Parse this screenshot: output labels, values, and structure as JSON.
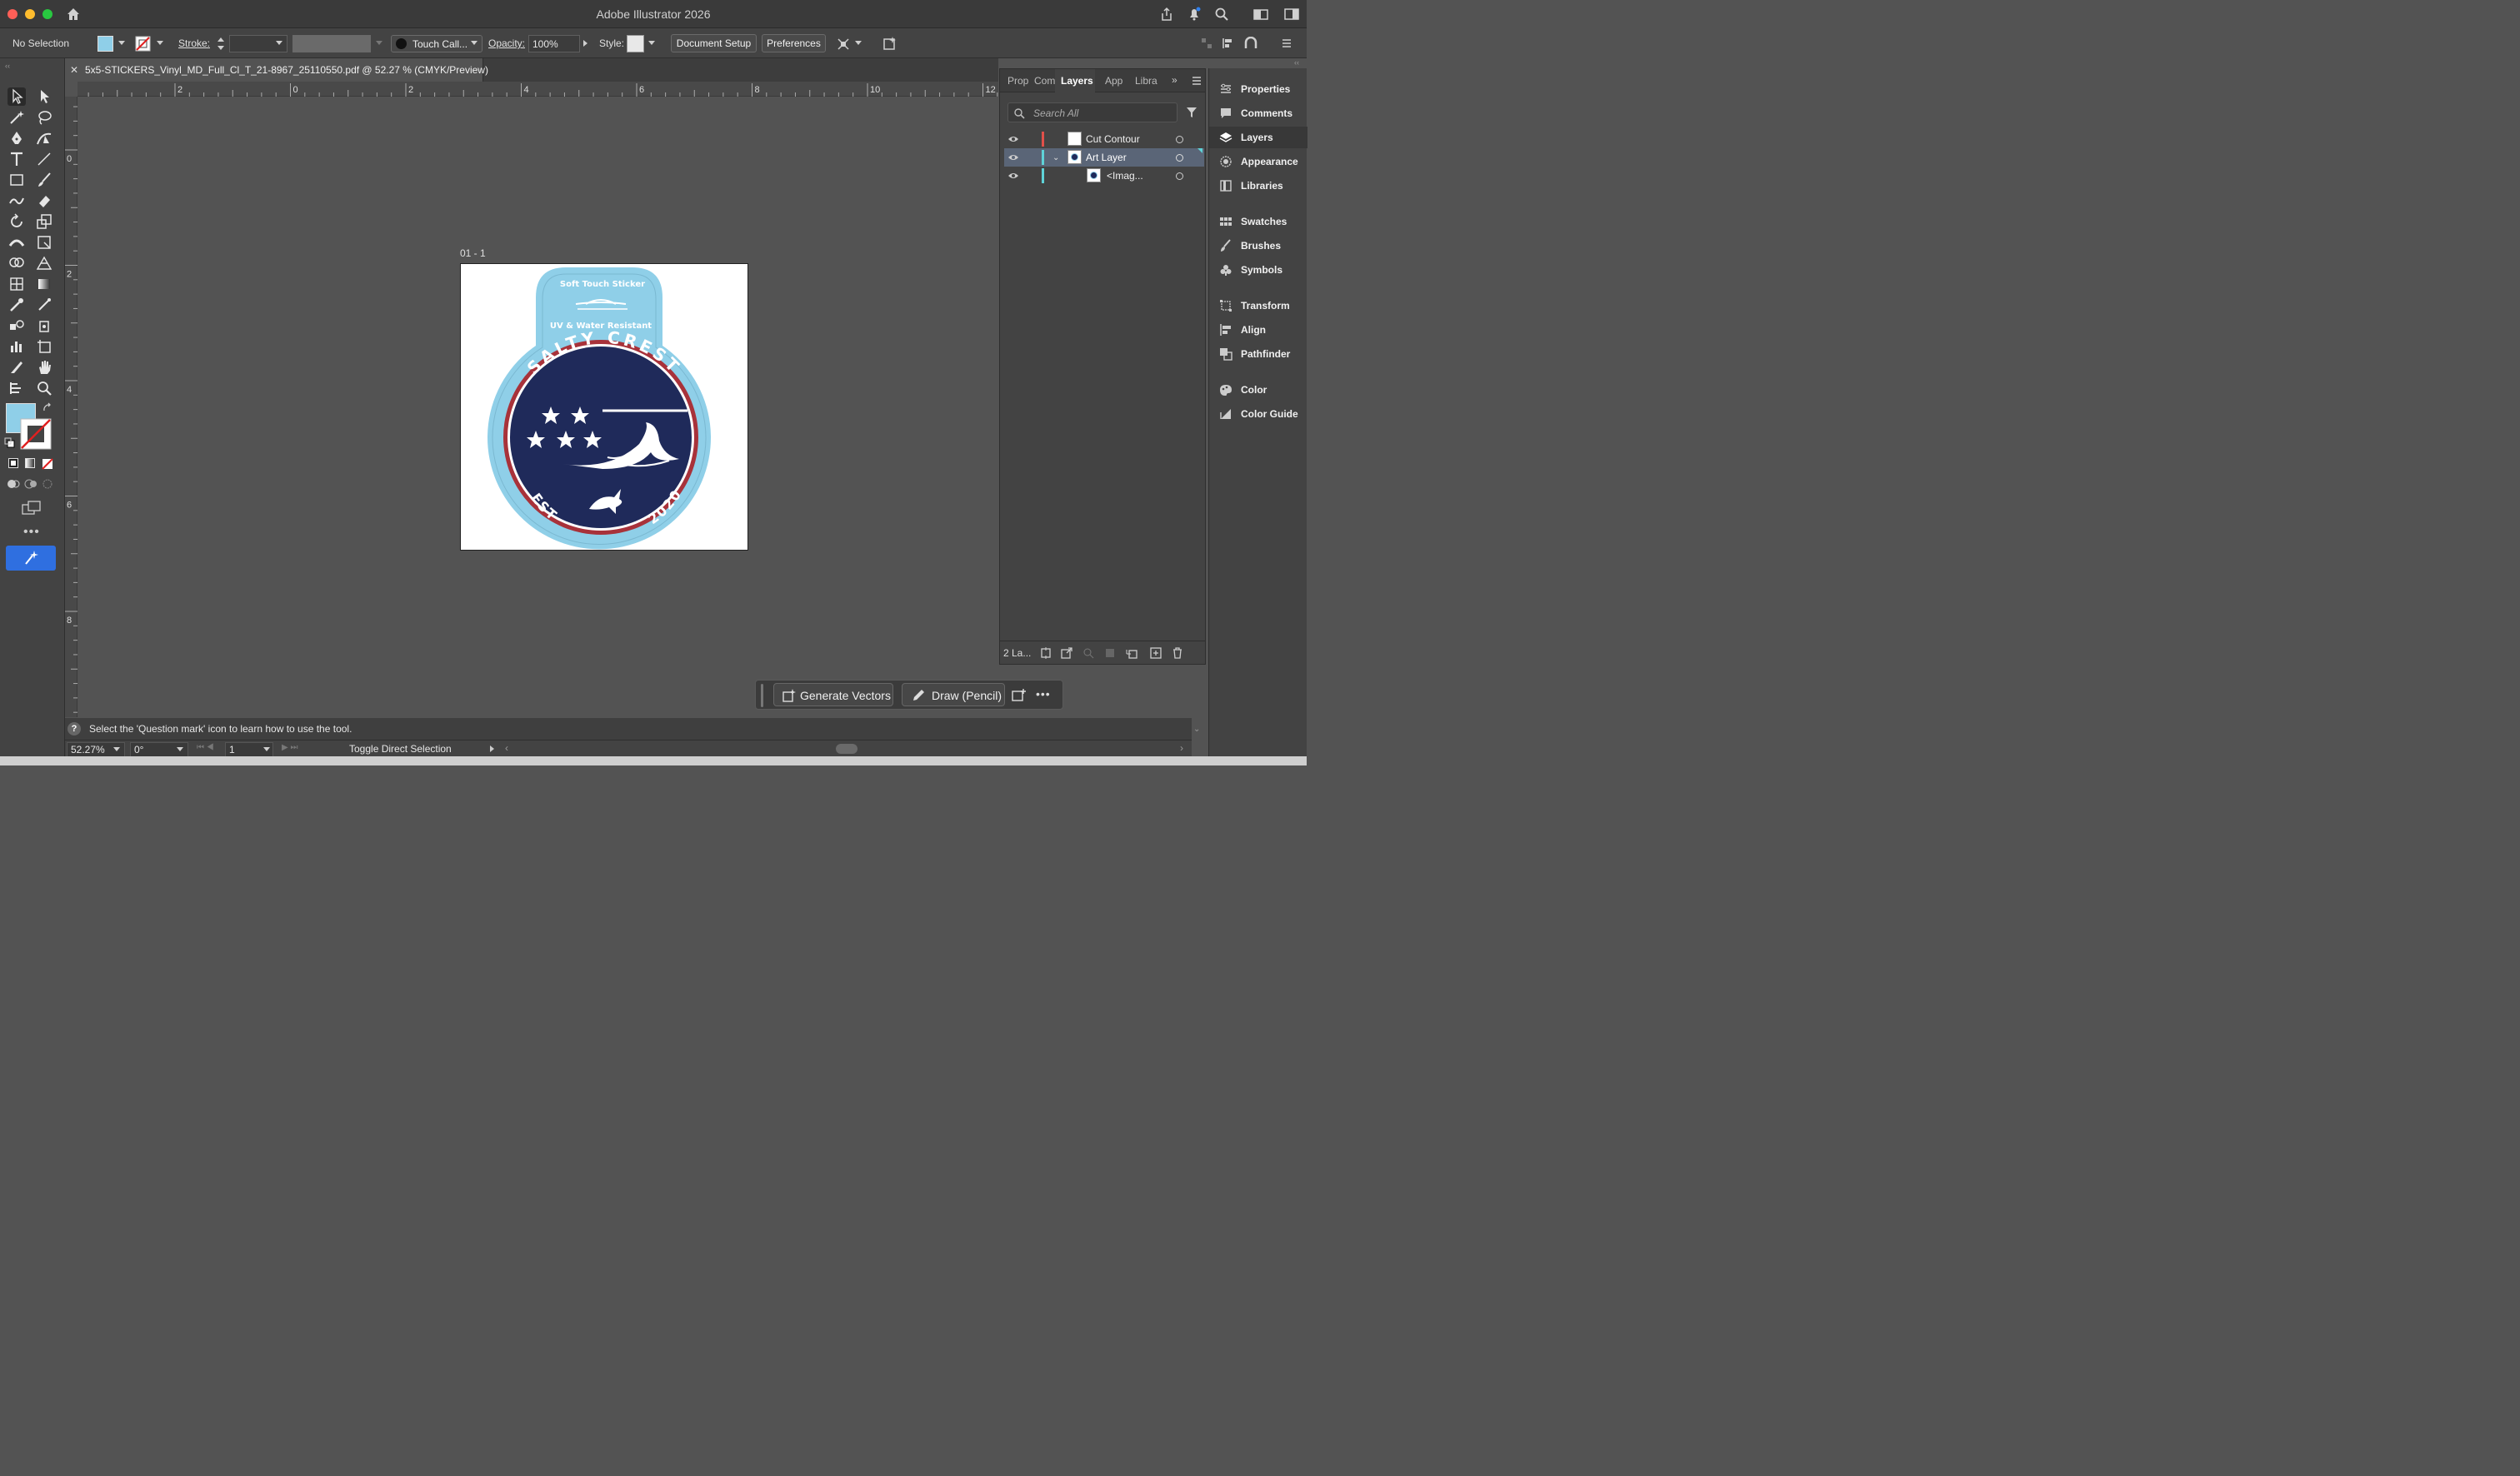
{
  "app": {
    "title": "Adobe Illustrator 2026"
  },
  "control_bar": {
    "selection": "No Selection",
    "stroke_label": "Stroke:",
    "brush_name": "Touch Call...",
    "opacity_label": "Opacity:",
    "opacity_value": "100%",
    "style_label": "Style:",
    "document_setup": "Document Setup",
    "preferences": "Preferences"
  },
  "document": {
    "tab_title": "5x5-STICKERS_Vinyl_MD_Full_Cl_T_21-8967_25110550.pdf @ 52.27 % (CMYK/Preview)",
    "artboard_name": "01 - 1"
  },
  "rulers": {
    "horizontal": [
      "2",
      "0",
      "2",
      "4",
      "6",
      "8",
      "10",
      "12"
    ],
    "vertical": [
      "0",
      "2",
      "4",
      "6",
      "8"
    ]
  },
  "sticker": {
    "top_text": "Soft Touch Sticker",
    "sub_text": "UV & Water Resistant",
    "brand": "SALTY CREST",
    "est": "EST",
    "year": "2020",
    "colors": {
      "light_blue": "#8fcfe8",
      "navy": "#1f2a5a",
      "red": "#a8323a"
    }
  },
  "layers_panel": {
    "tabs": [
      "Prop",
      "Com",
      "Layers",
      "App",
      "Libra"
    ],
    "active_tab": "Layers",
    "search_placeholder": "Search All",
    "rows": [
      {
        "name": "Cut Contour",
        "color": "#e0504a"
      },
      {
        "name": "Art Layer",
        "color": "#5fd3d8"
      },
      {
        "name": "<Imag...",
        "color": "#5fd3d8"
      }
    ],
    "footer_count": "2 La..."
  },
  "right_panel": {
    "items": [
      "Properties",
      "Comments",
      "Layers",
      "Appearance",
      "Libraries",
      "Swatches",
      "Brushes",
      "Symbols",
      "Transform",
      "Align",
      "Pathfinder",
      "Color",
      "Color Guide"
    ]
  },
  "taskbar": {
    "generate": "Generate Vectors",
    "draw": "Draw (Pencil)"
  },
  "status": {
    "hint": "Select the 'Question mark' icon to learn how to use the tool.",
    "zoom": "52.27%",
    "rotation": "0°",
    "page": "1",
    "tool_hint": "Toggle Direct Selection"
  }
}
